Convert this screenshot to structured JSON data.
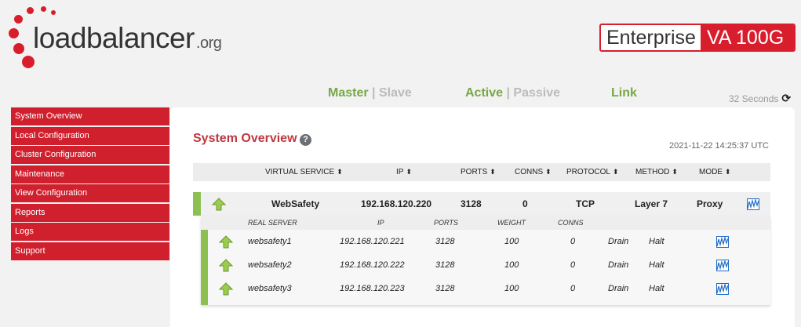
{
  "logo": {
    "name_bold": "loadbalancer",
    "tld": ".org"
  },
  "badge": {
    "edition": "Enterprise",
    "model": "VA 100G"
  },
  "status": {
    "master": "Master",
    "sep1": "|",
    "slave": "Slave",
    "active": "Active",
    "sep2": "|",
    "passive": "Passive",
    "link": "Link"
  },
  "refresh": {
    "label": "32 Seconds",
    "icon": "refresh-icon"
  },
  "sidebar": {
    "items": [
      {
        "label": "System Overview"
      },
      {
        "label": "Local Configuration"
      },
      {
        "label": "Cluster Configuration"
      },
      {
        "label": "Maintenance"
      },
      {
        "label": "View Configuration"
      },
      {
        "label": "Reports"
      },
      {
        "label": "Logs"
      },
      {
        "label": "Support"
      }
    ]
  },
  "main": {
    "title": "System Overview",
    "help": "?",
    "timestamp": "2021-11-22 14:25:37 UTC",
    "columns": {
      "virtual_service": "VIRTUAL SERVICE",
      "ip": "IP",
      "ports": "PORTS",
      "conns": "CONNS",
      "protocol": "PROTOCOL",
      "method": "METHOD",
      "mode": "MODE",
      "sort_glyph": "⬍"
    },
    "virtual_service": {
      "name": "WebSafety",
      "ip": "192.168.120.220",
      "ports": "3128",
      "conns": "0",
      "protocol": "TCP",
      "method": "Layer 7",
      "mode": "Proxy"
    },
    "rs_columns": {
      "real_server": "REAL SERVER",
      "ip": "IP",
      "ports": "PORTS",
      "weight": "WEIGHT",
      "conns": "CONNS"
    },
    "real_servers": [
      {
        "name": "websafety1",
        "ip": "192.168.120.221",
        "ports": "3128",
        "weight": "100",
        "conns": "0",
        "drain": "Drain",
        "halt": "Halt"
      },
      {
        "name": "websafety2",
        "ip": "192.168.120.222",
        "ports": "3128",
        "weight": "100",
        "conns": "0",
        "drain": "Drain",
        "halt": "Halt"
      },
      {
        "name": "websafety3",
        "ip": "192.168.120.223",
        "ports": "3128",
        "weight": "100",
        "conns": "0",
        "drain": "Drain",
        "halt": "Halt"
      }
    ]
  },
  "colors": {
    "brand_red": "#d81e2c",
    "sidebar_red": "#d0202e",
    "status_green": "#77a845",
    "row_green": "#8cc152",
    "chart_blue": "#1f6bc4"
  }
}
